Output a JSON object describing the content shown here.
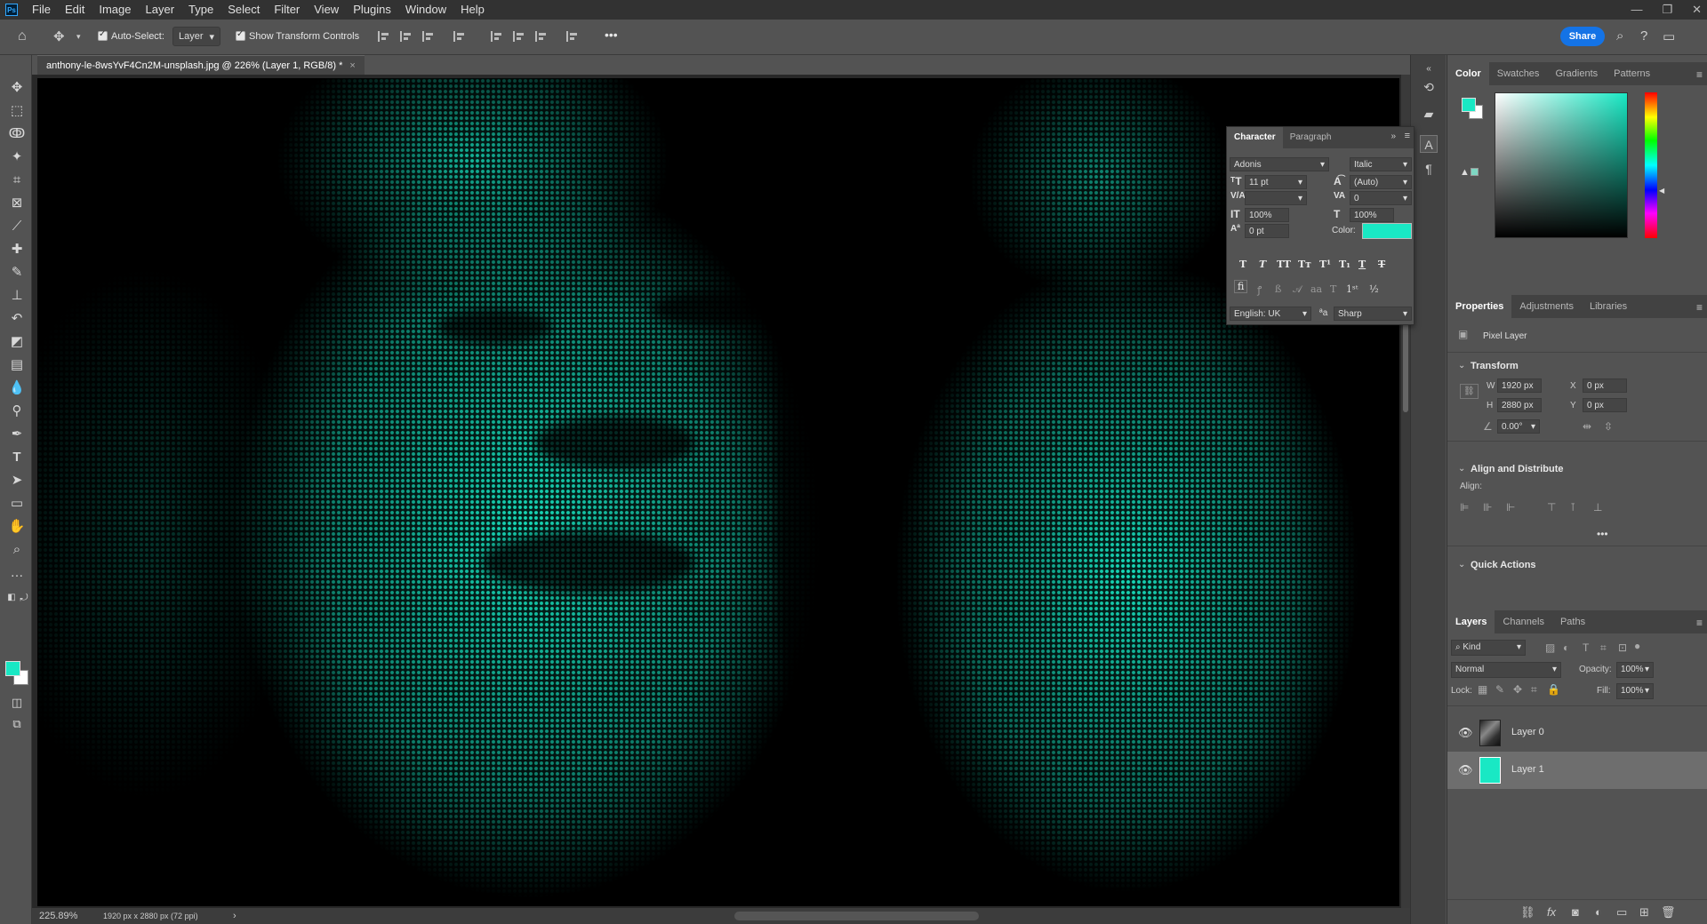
{
  "menubar": {
    "logo": "Ps",
    "items": [
      "File",
      "Edit",
      "Image",
      "Layer",
      "Type",
      "Select",
      "Filter",
      "View",
      "Plugins",
      "Window",
      "Help"
    ],
    "win_minimize": "—",
    "win_restore": "❐",
    "win_close": "✕"
  },
  "options": {
    "home_icon": "home-icon",
    "auto_select_label": "Auto-Select:",
    "auto_select_value": "Layer",
    "show_transform_label": "Show Transform Controls",
    "more": "•••",
    "share": "Share"
  },
  "document": {
    "tab_title": "anthony-le-8wsYvF4Cn2M-unsplash.jpg @ 226% (Layer 1, RGB/8) *",
    "zoom": "225.89%",
    "doc_info": "1920 px x 2880 px (72 ppi)",
    "status_arrow": "›"
  },
  "character_panel": {
    "tabs": [
      "Character",
      "Paragraph"
    ],
    "font_family": "Adonis",
    "font_style": "Italic",
    "font_size": "11 pt",
    "leading": "(Auto)",
    "kerning": "",
    "tracking": "0",
    "vertical_scale": "100%",
    "horizontal_scale": "100%",
    "baseline_shift": "0 pt",
    "color_label": "Color:",
    "color": "#19e8c4",
    "language": "English: UK",
    "aa_label": "ªa",
    "antialias": "Sharp",
    "ligature_label": "fi"
  },
  "color_panel": {
    "tabs": [
      "Color",
      "Swatches",
      "Gradients",
      "Patterns"
    ],
    "foreground": "#19e8c4",
    "background": "#ffffff"
  },
  "properties_panel": {
    "tabs": [
      "Properties",
      "Adjustments",
      "Libraries"
    ],
    "layer_type": "Pixel Layer",
    "transform_title": "Transform",
    "w_label": "W",
    "w_value": "1920 px",
    "h_label": "H",
    "h_value": "2880 px",
    "x_label": "X",
    "x_value": "0 px",
    "y_label": "Y",
    "y_value": "0 px",
    "angle": "0.00°",
    "align_title": "Align and Distribute",
    "align_label": "Align:",
    "more": "•••",
    "quick_actions_title": "Quick Actions"
  },
  "layers_panel": {
    "tabs": [
      "Layers",
      "Channels",
      "Paths"
    ],
    "filter_label": "Kind",
    "blend_mode": "Normal",
    "opacity_label": "Opacity:",
    "opacity": "100%",
    "lock_label": "Lock:",
    "fill_label": "Fill:",
    "fill": "100%",
    "layers": [
      {
        "name": "Layer 0",
        "visible": true,
        "selected": false
      },
      {
        "name": "Layer 1",
        "visible": true,
        "selected": true
      }
    ]
  },
  "accent": "#19e8c4"
}
